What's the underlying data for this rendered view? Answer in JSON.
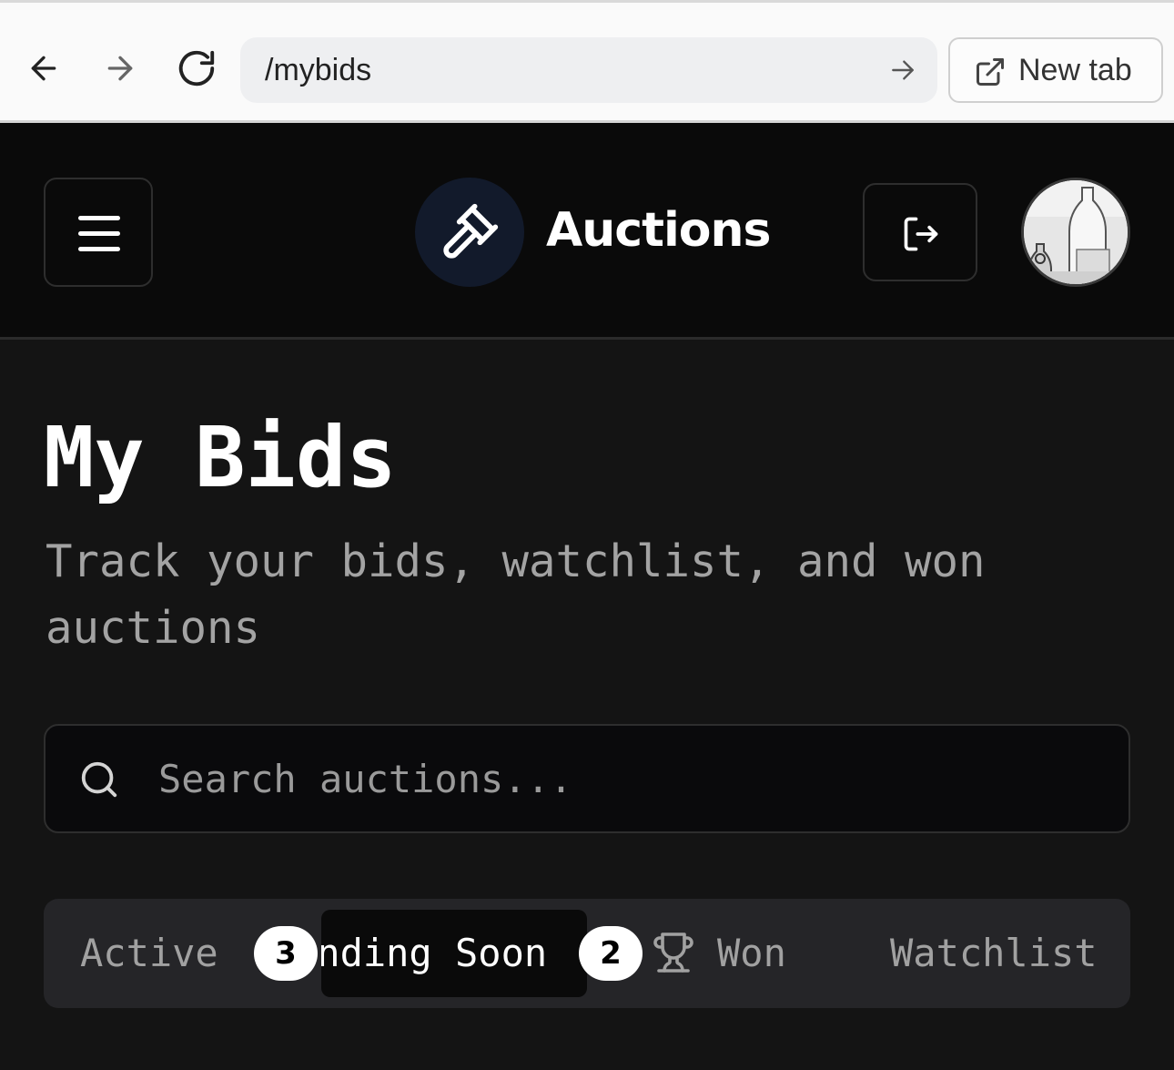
{
  "browser": {
    "url": "/mybids",
    "new_tab_label": "New tab"
  },
  "header": {
    "brand": "Auctions"
  },
  "main": {
    "title": "My Bids",
    "subtitle": "Track your bids, watchlist, and won auctions",
    "search_placeholder": "Search auctions..."
  },
  "tabs": [
    {
      "label": "Active",
      "badge": "3"
    },
    {
      "label": "Ending Soon",
      "badge": "2",
      "selected": true
    },
    {
      "label": "Won",
      "icon": "trophy-icon"
    },
    {
      "label": "Watchlist"
    }
  ],
  "colors": {
    "background": "#141414",
    "header_bg": "#0a0a0a",
    "logo_bg": "#121a2b",
    "text_primary": "#ffffff",
    "text_muted": "#a3a3a3"
  }
}
